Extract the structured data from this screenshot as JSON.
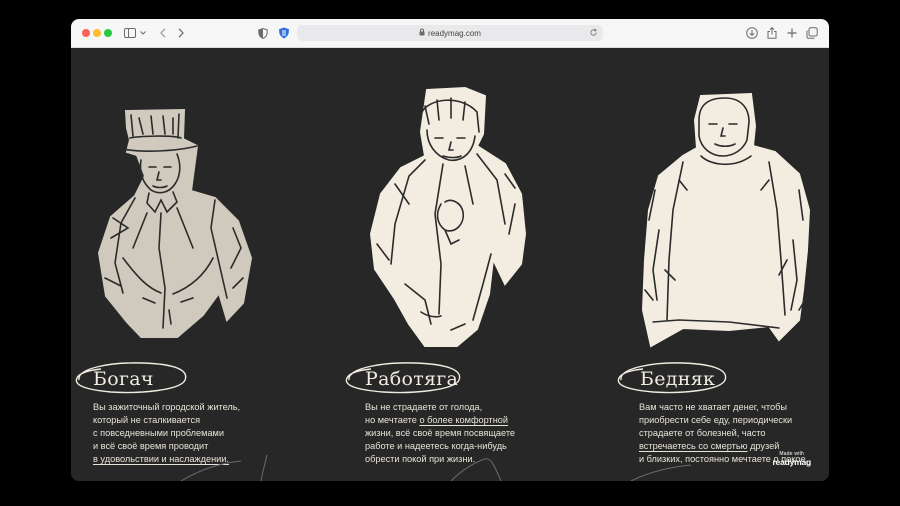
{
  "browser": {
    "url": "readymag.com"
  },
  "characters": [
    {
      "title": "Богач",
      "lines": [
        {
          "parts": [
            {
              "text": "Вы зажиточный городской житель,",
              "u": false
            }
          ]
        },
        {
          "parts": [
            {
              "text": "который не сталкивается",
              "u": false
            }
          ]
        },
        {
          "parts": [
            {
              "text": "с повседневными проблемами",
              "u": false
            }
          ]
        },
        {
          "parts": [
            {
              "text": "и всё своё время проводит",
              "u": false
            }
          ]
        },
        {
          "parts": [
            {
              "text": "в удовольствии и наслаждении.",
              "u": true
            }
          ]
        }
      ]
    },
    {
      "title": "Работяга",
      "lines": [
        {
          "parts": [
            {
              "text": "Вы не страдаете от голода,",
              "u": false
            }
          ]
        },
        {
          "parts": [
            {
              "text": "но мечтаете ",
              "u": false
            },
            {
              "text": "о более комфортной",
              "u": true
            }
          ]
        },
        {
          "parts": [
            {
              "text": "жизни, всё своё время посвящаете",
              "u": false
            }
          ]
        },
        {
          "parts": [
            {
              "text": "работе и надеетесь когда-нибудь",
              "u": false
            }
          ]
        },
        {
          "parts": [
            {
              "text": "обрести покой при жизни.",
              "u": false
            }
          ]
        }
      ]
    },
    {
      "title": "Бедняк",
      "lines": [
        {
          "parts": [
            {
              "text": "Вам часто не хватает денег, чтобы",
              "u": false
            }
          ]
        },
        {
          "parts": [
            {
              "text": "приобрести себе еду, периодически",
              "u": false
            }
          ]
        },
        {
          "parts": [
            {
              "text": "страдаете от болезней, часто",
              "u": false
            }
          ]
        },
        {
          "parts": [
            {
              "text": "встречаетесь со смертью",
              "u": true
            },
            {
              "text": " друзей",
              "u": false
            }
          ]
        },
        {
          "parts": [
            {
              "text": "и близких, постоянно мечтаете о покое.",
              "u": false
            }
          ]
        }
      ]
    }
  ],
  "badge": {
    "made_with": "Made with",
    "brand": "readymag"
  },
  "colors": {
    "background": "#272727",
    "paper_light": "#f3ede1",
    "paper_grey": "#cfcabd",
    "ink": "#2b2b2b",
    "text": "#e8e3d8"
  }
}
